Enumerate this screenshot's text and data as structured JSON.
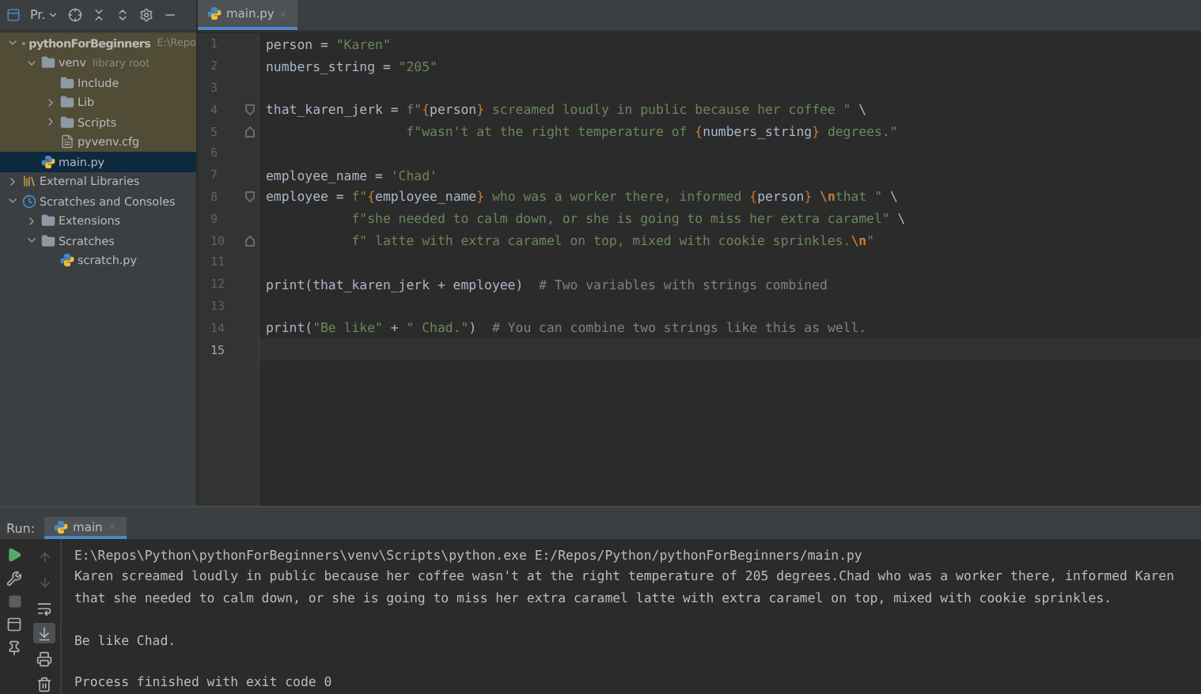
{
  "project_panel": {
    "title": "Pr.",
    "tree": [
      {
        "label": "pythonForBeginners",
        "note": "E:\\Repo",
        "kind": "folder",
        "expanded": true,
        "highlighted": true,
        "selected": false,
        "children": [
          {
            "label": "venv",
            "note": "library root",
            "kind": "folder",
            "expanded": true,
            "highlighted": true,
            "selected": false,
            "children": [
              {
                "label": "Include",
                "kind": "folder",
                "highlighted": true,
                "selected": false
              },
              {
                "label": "Lib",
                "kind": "folder",
                "expanded": false,
                "highlighted": true,
                "selected": false
              },
              {
                "label": "Scripts",
                "kind": "folder",
                "expanded": false,
                "highlighted": true,
                "selected": false
              },
              {
                "label": "pyvenv.cfg",
                "kind": "config",
                "highlighted": true,
                "selected": false
              }
            ]
          },
          {
            "label": "main.py",
            "kind": "python",
            "highlighted": false,
            "selected": true
          }
        ]
      },
      {
        "label": "External Libraries",
        "kind": "library",
        "expanded": false,
        "highlighted": false,
        "selected": false
      },
      {
        "label": "Scratches and Consoles",
        "kind": "scratches",
        "expanded": true,
        "highlighted": false,
        "selected": false,
        "children": [
          {
            "label": "Extensions",
            "kind": "folder",
            "expanded": false,
            "highlighted": false,
            "selected": false
          },
          {
            "label": "Scratches",
            "kind": "folder",
            "expanded": true,
            "highlighted": false,
            "selected": false,
            "children": [
              {
                "label": "scratch.py",
                "kind": "python",
                "highlighted": false,
                "selected": false
              }
            ]
          }
        ]
      }
    ]
  },
  "editor": {
    "tabs": [
      {
        "label": "main.py",
        "selected": true
      }
    ],
    "lines": [
      {
        "number": "1",
        "current": false,
        "fold_start": false,
        "fold_end": false,
        "tokens": [
          {
            "kind": "code",
            "text": "person = "
          },
          {
            "kind": "string",
            "text": "\"Karen\""
          }
        ]
      },
      {
        "number": "2",
        "current": false,
        "fold_start": false,
        "fold_end": false,
        "tokens": [
          {
            "kind": "code",
            "text": "numbers_string = "
          },
          {
            "kind": "string",
            "text": "\"205\""
          }
        ]
      },
      {
        "number": "3",
        "current": false,
        "fold_start": false,
        "fold_end": false
      },
      {
        "number": "4",
        "current": false,
        "fold_start": true,
        "fold_end": false,
        "tokens": [
          {
            "kind": "code",
            "text": "that_karen_jerk = "
          },
          {
            "kind": "string",
            "text": "f\""
          },
          {
            "kind": "brace",
            "text": "{"
          },
          {
            "kind": "code",
            "text": "person"
          },
          {
            "kind": "brace",
            "text": "}"
          },
          {
            "kind": "string",
            "text": " screamed loudly in public because her coffee \" "
          },
          {
            "kind": "code",
            "text": "\\"
          }
        ]
      },
      {
        "number": "5",
        "current": false,
        "fold_start": false,
        "fold_end": true,
        "tokens": [
          {
            "kind": "string",
            "text": "                  f\"wasn't at the right temperature of "
          },
          {
            "kind": "brace",
            "text": "{"
          },
          {
            "kind": "code",
            "text": "numbers_string"
          },
          {
            "kind": "brace",
            "text": "}"
          },
          {
            "kind": "string",
            "text": " degrees.\""
          }
        ]
      },
      {
        "number": "6",
        "current": false,
        "fold_start": false,
        "fold_end": false
      },
      {
        "number": "7",
        "current": false,
        "fold_start": false,
        "fold_end": false,
        "tokens": [
          {
            "kind": "code",
            "text": "employee_name = "
          },
          {
            "kind": "string",
            "text": "'Chad'"
          }
        ]
      },
      {
        "number": "8",
        "current": false,
        "fold_start": true,
        "fold_end": false,
        "tokens": [
          {
            "kind": "code",
            "text": "employee = "
          },
          {
            "kind": "string",
            "text": "f\""
          },
          {
            "kind": "brace",
            "text": "{"
          },
          {
            "kind": "code",
            "text": "employee_name"
          },
          {
            "kind": "brace",
            "text": "}"
          },
          {
            "kind": "string",
            "text": " who was a worker there, informed "
          },
          {
            "kind": "brace",
            "text": "{"
          },
          {
            "kind": "code",
            "text": "person"
          },
          {
            "kind": "brace",
            "text": "}"
          },
          {
            "kind": "escape",
            "text": " \\n"
          },
          {
            "kind": "string",
            "text": "that \" "
          },
          {
            "kind": "code",
            "text": "\\"
          }
        ]
      },
      {
        "number": "9",
        "current": false,
        "fold_start": false,
        "fold_end": false,
        "tokens": [
          {
            "kind": "string",
            "text": "           f\"she needed to calm down, or she is going to miss her extra caramel\" "
          },
          {
            "kind": "code",
            "text": "\\"
          }
        ]
      },
      {
        "number": "10",
        "current": false,
        "fold_start": false,
        "fold_end": true,
        "tokens": [
          {
            "kind": "string",
            "text": "           f\" latte with extra caramel on top, mixed with cookie sprinkles."
          },
          {
            "kind": "escape",
            "text": "\\n"
          },
          {
            "kind": "string",
            "text": "\""
          }
        ]
      },
      {
        "number": "11",
        "current": false,
        "fold_start": false,
        "fold_end": false
      },
      {
        "number": "12",
        "current": false,
        "fold_start": false,
        "fold_end": false,
        "tokens": [
          {
            "kind": "code",
            "text": "print(that_karen_jerk + employee)  "
          },
          {
            "kind": "comment",
            "text": "# Two variables with strings combined"
          }
        ]
      },
      {
        "number": "13",
        "current": false,
        "fold_start": false,
        "fold_end": false
      },
      {
        "number": "14",
        "current": false,
        "fold_start": false,
        "fold_end": false,
        "tokens": [
          {
            "kind": "code",
            "text": "print("
          },
          {
            "kind": "string",
            "text": "\"Be like\""
          },
          {
            "kind": "code",
            "text": " + "
          },
          {
            "kind": "string",
            "text": "\" Chad.\""
          },
          {
            "kind": "code",
            "text": ")  "
          },
          {
            "kind": "comment",
            "text": "# You can combine two strings like this as well."
          }
        ]
      },
      {
        "number": "15",
        "current": true,
        "fold_start": false,
        "fold_end": false
      }
    ]
  },
  "run_panel": {
    "label": "Run:",
    "tabs": [
      {
        "label": "main",
        "selected": true
      }
    ],
    "scroll_to_end": true,
    "output": [
      [
        "E:\\Repos\\Python\\pythonForBeginners\\venv\\Scripts\\python.exe E:/Repos/Python/pythonForBeginners/main.py",
        "Karen screamed loudly in public because her coffee wasn't at the right temperature of 205 degrees.Chad who was a worker there, informed Karen",
        "that she needed to calm down, or she is going to miss her extra caramel latte with extra caramel on top, mixed with cookie sprinkles."
      ],
      [
        "Be like Chad."
      ],
      [
        "Process finished with exit code 0"
      ]
    ]
  }
}
